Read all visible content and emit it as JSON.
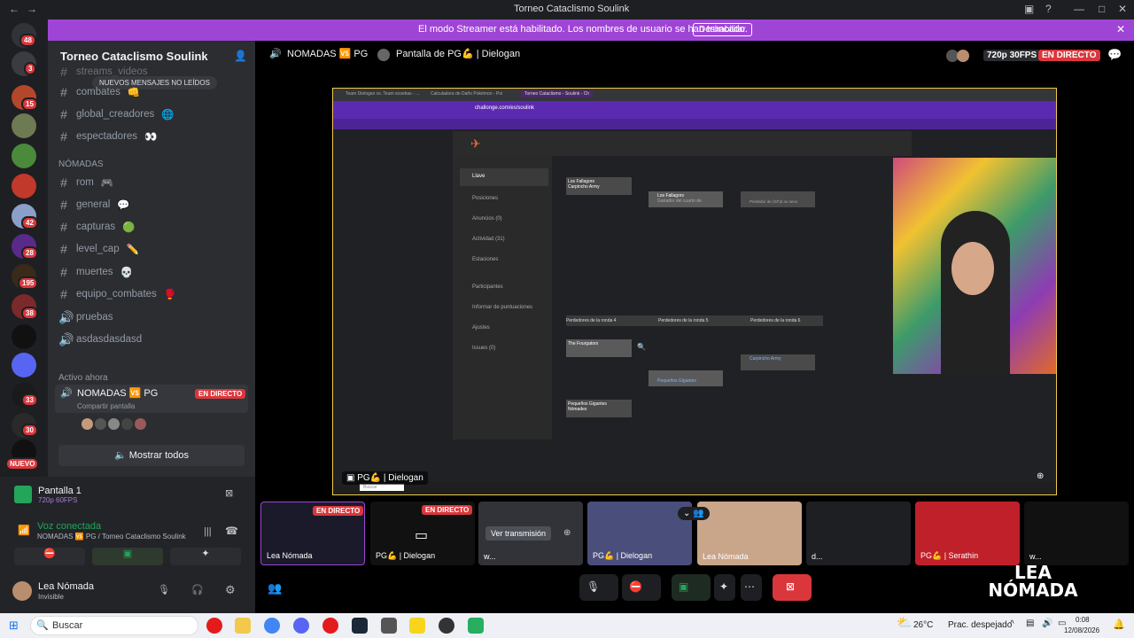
{
  "window": {
    "title": "Torneo Cataclismo Soulink"
  },
  "banner": {
    "message": "El modo Streamer está habilitado. Los nombres de usuario se han truncado.",
    "button": "Deshabilitar"
  },
  "guilds": {
    "badges": [
      "48",
      "3",
      "15",
      "42",
      "28",
      "195",
      "38",
      "33",
      "30"
    ],
    "new_label": "NUEVO"
  },
  "server": {
    "name": "Torneo Cataclismo Soulink",
    "partial_top": "streams_videos",
    "new_messages": "NUEVOS MENSAJES NO LEÍDOS"
  },
  "channels": [
    {
      "name": "combates",
      "emoji": "👊"
    },
    {
      "name": "global_creadores",
      "emoji": "🌐"
    },
    {
      "name": "espectadores",
      "emoji": "👀"
    }
  ],
  "category": "NÓMADAS",
  "channels2": [
    {
      "name": "rom",
      "emoji": "🎮"
    },
    {
      "name": "general",
      "emoji": "💬"
    },
    {
      "name": "capturas",
      "emoji": "🟢"
    },
    {
      "name": "level_cap",
      "emoji": "✏️"
    },
    {
      "name": "muertes",
      "emoji": "💀"
    },
    {
      "name": "equipo_combates",
      "emoji": "🥊"
    }
  ],
  "voice_channels": [
    "pruebas",
    "asdasdasdasd"
  ],
  "active_now": "Activo ahora",
  "active_channel": {
    "name": "NOMADAS 🆚 PG",
    "badge": "EN DIRECTO",
    "sub": "Compartir pantalla"
  },
  "show_all": "Mostrar todos",
  "panel": {
    "screen_title": "Pantalla 1",
    "screen_quality": "720p 60FPS",
    "voice_status": "Voz conectada",
    "voice_location": "NOMADAS 🆚 PG / Torneo Cataclismo Soulink",
    "user_name": "Lea Nómada",
    "user_status": "Invisible"
  },
  "stage": {
    "channel": "NOMADAS 🆚 PG",
    "screen_of": "Pantalla de PG💪 | Dielogan",
    "quality": "720p 30FPS",
    "live": "EN DIRECTO",
    "stream_label": "PG💪 | Dielogan"
  },
  "browser": {
    "url": "challonge.com/es/soulink",
    "tabs": [
      "Team Dielogan vs. Team sosebas - ...",
      "Calculadora de Daño Pokémon - Poi",
      "Torneo Cataclismo - Soulink - Ch"
    ],
    "sidebar": [
      "Llave",
      "Posiciones",
      "Anuncios (0)",
      "Actividad (31)",
      "Estaciones",
      "Participantes",
      "Informar de puntuaciones",
      "Ajustes",
      "Issues (0)"
    ],
    "rounds": [
      "Perdedores de la ronda 4",
      "Perdedores de la ronda 5",
      "Perdedores de la ronda 6"
    ],
    "bracket": [
      "Los Fallagors",
      "Carpincho Army",
      "Los Fallagors",
      "Ganador del cuarto de",
      "Perdedor de (SF)2 ou seco",
      "The Fourgators",
      "Pequeños Gigantes",
      "Carpincho Army",
      "Pequeños Gigantes",
      "Nómades"
    ],
    "search": "Buscar"
  },
  "tiles": [
    {
      "label": "Lea Nómada",
      "live": "EN DIRECTO"
    },
    {
      "label": "PG💪 | Dielogan",
      "live": "EN DIRECTO"
    },
    {
      "label": "w...",
      "button": "Ver transmisión"
    },
    {
      "label": "PG💪 | Dielogan"
    },
    {
      "label": "Lea Nómada"
    },
    {
      "label": "d..."
    },
    {
      "label": "PG💪 | Serathin"
    },
    {
      "label": "w..."
    }
  ],
  "overlay": {
    "line1": "LEA",
    "line2": "NÓMADA"
  },
  "taskbar": {
    "search": "Buscar",
    "weather": "26°C",
    "weather_desc": "Prac. despejado",
    "time": "0:08",
    "date": "12/08/2026"
  },
  "colors": {
    "banner": "#9f45d6",
    "live": "#da373c",
    "green": "#23a55a",
    "accent": "#5865f2"
  }
}
